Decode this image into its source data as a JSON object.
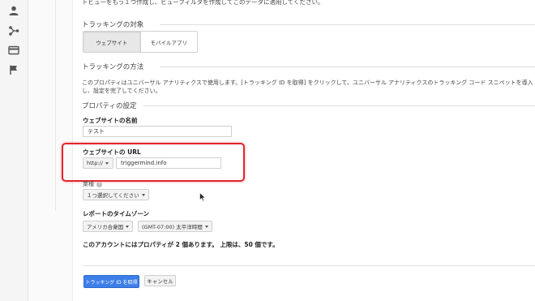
{
  "sidebar": {
    "icons": [
      "person-icon",
      "share-icon",
      "card-icon",
      "flag-icon"
    ]
  },
  "top_note": "トビューをもう１つ作成し、ビューフィルタを作成してこのデータに適用してください。",
  "tracking_target": {
    "heading": "トラッキングの対象",
    "options": [
      "ウェブサイト",
      "モバイルアプリ"
    ],
    "selected": "ウェブサイト"
  },
  "tracking_method": {
    "heading": "トラッキングの方法",
    "description": "このプロパティはユニバーサル アナリティクスで使用します。[トラッキング ID を取得] をクリックして、ユニバーサル アナリティクスのトラッキング コード スニペットを導入し、設定を完了してください。"
  },
  "property_settings": {
    "heading": "プロパティの設定",
    "site_name_label": "ウェブサイトの名前",
    "site_name_value": "テスト",
    "url_label": "ウェブサイトの URL",
    "protocol": "http://",
    "url_value": "triggermind.info",
    "category_label": "業種",
    "category_select": "１つ選択してください",
    "timezone_label": "レポートのタイムゾーン",
    "country_select": "アメリカ合衆国",
    "timezone_select": "(GMT-07:00) 太平洋時間",
    "account_note": "このアカウントにはプロパティが 2 個あります。 上限は、50 個です。"
  },
  "actions": {
    "get_id": "トラッキング ID を取得",
    "cancel": "キャンセル"
  },
  "colors": {
    "highlight": "#e0262c",
    "primary": "#3d7ee8"
  }
}
